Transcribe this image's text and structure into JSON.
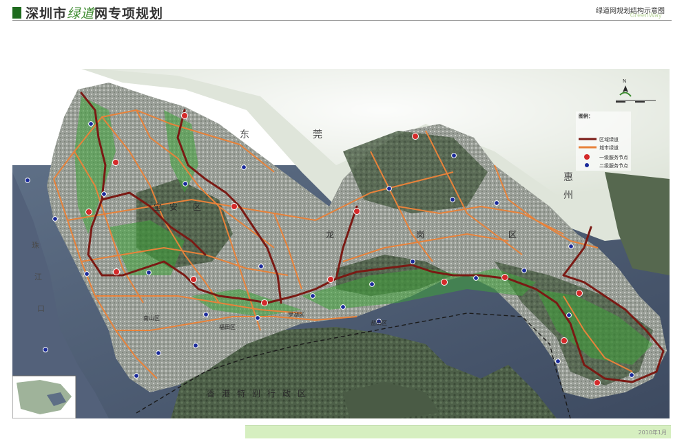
{
  "header": {
    "title_part1": "深圳市",
    "title_highlight": "绿道",
    "title_part2": "网专项规划",
    "sheet_title": "绿道网规划结构示意图",
    "brand": "GreenWay"
  },
  "map": {
    "labels": {
      "dongguan_1": "东",
      "dongguan_2": "莞",
      "huizhou_1": "惠",
      "huizhou_2": "州",
      "hongkong": "香港特别行政区",
      "district_1": "宝",
      "district_2": "安",
      "district_3": "区",
      "longgang_1": "龙",
      "longgang_2": "岗",
      "longgang_3": "区",
      "river_1": "珠",
      "river_2": "江",
      "river_3": "口",
      "futian": "福田区",
      "nanshan": "南山区",
      "luohu": "罗湖区",
      "yantian": "盐田区"
    },
    "north_label": "N",
    "legend": {
      "title": "图例：",
      "items": [
        {
          "label": "区域绿道",
          "color": "#7a1a14",
          "kind": "line"
        },
        {
          "label": "城市绿道",
          "color": "#e8823a",
          "kind": "line"
        },
        {
          "label": "一级服务节点",
          "color": "#d42a2a",
          "kind": "dot"
        },
        {
          "label": "二级服务节点",
          "color": "#1a2a9a",
          "kind": "dot"
        }
      ]
    }
  },
  "footer": {
    "date": "2010年1月"
  },
  "colors": {
    "regional_greenway": "#7a1a14",
    "city_greenway": "#e8823a",
    "primary_node": "#d42a2a",
    "secondary_node": "#1a2a9a",
    "footer_bg": "#d6efc0",
    "title_square": "#1e6b1e"
  }
}
